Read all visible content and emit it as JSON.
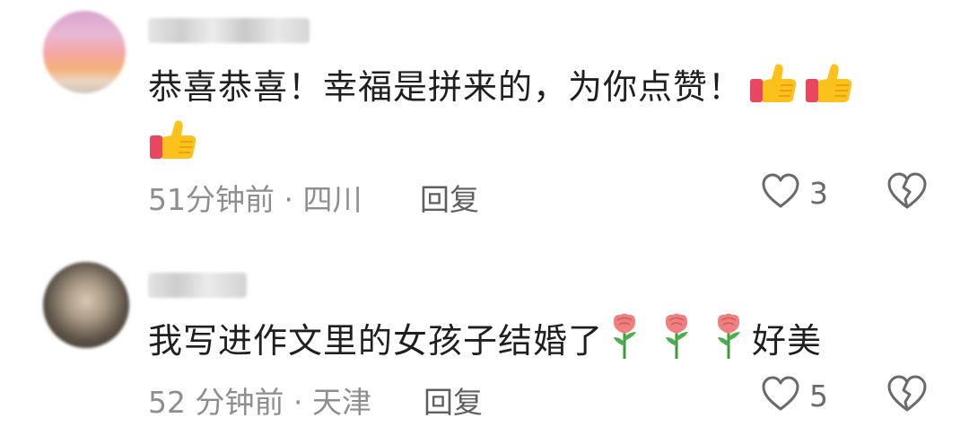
{
  "comments": [
    {
      "text": "恭喜恭喜！幸福是拼来的，为你点赞！",
      "emojis": [
        "thumbs-up-emoji",
        "thumbs-up-emoji",
        "thumbs-up-emoji"
      ],
      "time": "51分钟前",
      "location": "四川",
      "meta": "51分钟前 · 四川",
      "reply_label": "回复",
      "like_count": "3",
      "like_icon": "heart-outline-icon",
      "dislike_icon": "broken-heart-icon"
    },
    {
      "text": "我写进作文里的女孩子结婚了",
      "emojis": [
        "rose-emoji",
        "rose-emoji",
        "rose-emoji"
      ],
      "text_after": "好美",
      "time": "52 分钟前",
      "location": "天津",
      "meta": "52 分钟前 · 天津",
      "reply_label": "回复",
      "like_count": "5",
      "like_icon": "heart-outline-icon",
      "dislike_icon": "broken-heart-icon"
    }
  ],
  "colors": {
    "text": "#1f1f1f",
    "meta": "#8e8e8e",
    "reply": "#5f5f5f",
    "icon": "#6a6a6a"
  }
}
